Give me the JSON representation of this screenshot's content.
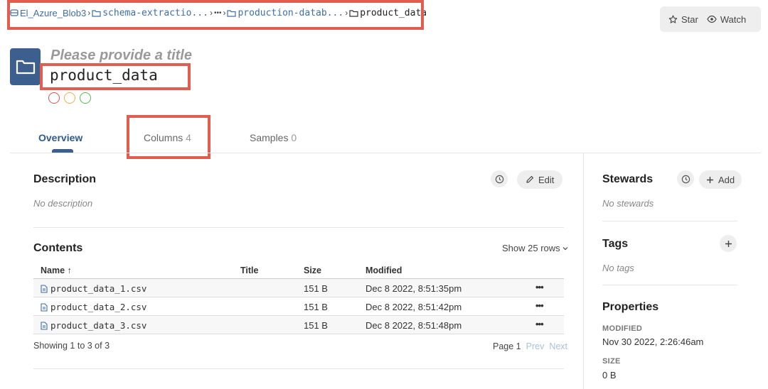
{
  "breadcrumb": {
    "items": [
      "El_Azure_Blob3",
      "schema-extractio...",
      "•••",
      "production-datab...",
      "product_data"
    ]
  },
  "header": {
    "star_label": "Star",
    "watch_label": "Watch",
    "title_placeholder": "Please provide a title",
    "dataset_name": "product_data",
    "circle_colors": [
      "#d9534f",
      "#f0ad4e",
      "#5cb85c"
    ]
  },
  "tabs": [
    {
      "label": "Overview",
      "count": ""
    },
    {
      "label": "Columns",
      "count": "4"
    },
    {
      "label": "Samples",
      "count": "0"
    }
  ],
  "description": {
    "heading": "Description",
    "edit_label": "Edit",
    "empty_text": "No description"
  },
  "contents": {
    "heading": "Contents",
    "show_rows": "Show 25 rows",
    "columns": [
      "Name",
      "Title",
      "Size",
      "Modified"
    ],
    "sort_indicator": "↑",
    "rows": [
      {
        "name": "product_data_1.csv",
        "title": "",
        "size": "151 B",
        "modified": "Dec 8 2022, 8:51:35pm"
      },
      {
        "name": "product_data_2.csv",
        "title": "",
        "size": "151 B",
        "modified": "Dec 8 2022, 8:51:42pm"
      },
      {
        "name": "product_data_3.csv",
        "title": "",
        "size": "151 B",
        "modified": "Dec 8 2022, 8:51:48pm"
      }
    ],
    "row_menu": "•••",
    "showing": "Showing 1 to 3 of 3",
    "page": "Page 1",
    "prev": "Prev",
    "next": "Next"
  },
  "sidebar": {
    "stewards_heading": "Stewards",
    "add_label": "Add",
    "stewards_empty": "No stewards",
    "tags_heading": "Tags",
    "tags_empty": "No tags",
    "properties_heading": "Properties",
    "modified_label": "MODIFIED",
    "modified_value": "Nov 30 2022, 2:26:46am",
    "size_label": "SIZE",
    "size_value": "0 B"
  },
  "colors": {
    "accent": "#3d5f8e",
    "link": "#3d6fa8",
    "highlight": "#e05d4f"
  },
  "icons": [
    "storage-icon",
    "folder-icon",
    "chevron-right-icon",
    "star-icon",
    "eye-icon",
    "clock-icon",
    "pencil-icon",
    "plus-icon",
    "file-icon",
    "more-icon",
    "chevron-down-icon"
  ]
}
